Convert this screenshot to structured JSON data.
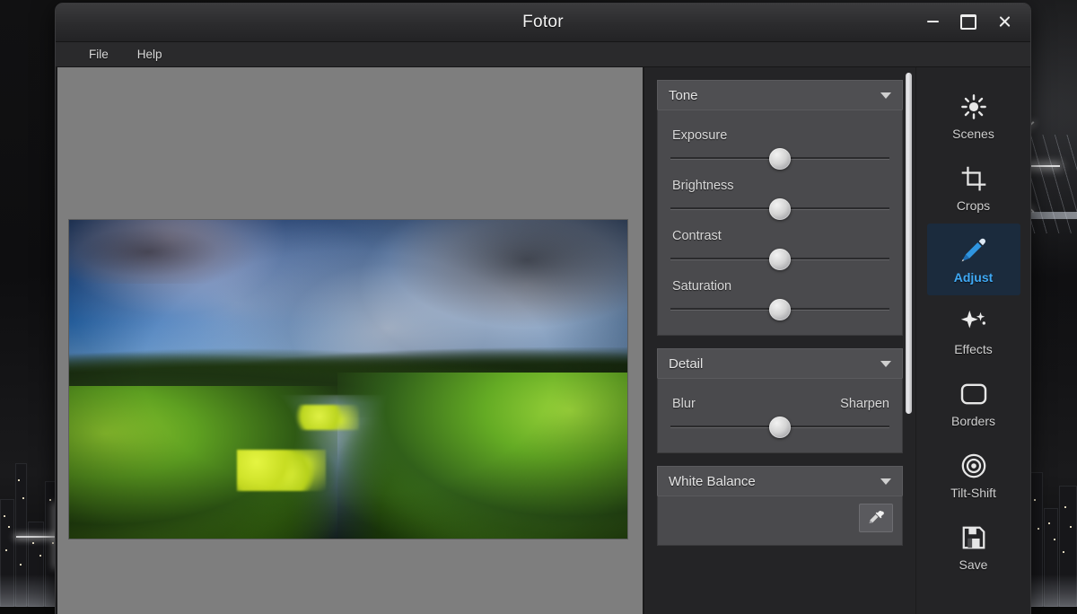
{
  "window": {
    "title": "Fotor",
    "controls": [
      {
        "name": "minimize",
        "label": "Minimize"
      },
      {
        "name": "maximize",
        "label": "Maximize"
      },
      {
        "name": "close",
        "label": "Close"
      }
    ]
  },
  "menu": {
    "items": [
      {
        "label": "File"
      },
      {
        "label": "Help"
      }
    ]
  },
  "canvas": {
    "background_color": "#7e7e7e",
    "photo_alt": "Landscape photo of a river winding through green marsh grass under a dramatic blue sky with white and grey clouds"
  },
  "panel": {
    "sections": [
      {
        "title": "Tone",
        "expanded": true,
        "caret": "chevron-down-icon",
        "sliders": [
          {
            "label": "Exposure",
            "value": 50,
            "min": 0,
            "max": 100
          },
          {
            "label": "Brightness",
            "value": 50,
            "min": 0,
            "max": 100
          },
          {
            "label": "Contrast",
            "value": 50,
            "min": 0,
            "max": 100
          },
          {
            "label": "Saturation",
            "value": 50,
            "min": 0,
            "max": 100
          }
        ]
      },
      {
        "title": "Detail",
        "expanded": true,
        "caret": "chevron-down-icon",
        "sliders": [
          {
            "label_left": "Blur",
            "label_right": "Sharpen",
            "value": 50,
            "min": 0,
            "max": 100
          }
        ]
      },
      {
        "title": "White Balance",
        "expanded": true,
        "caret": "chevron-down-icon",
        "picker_icon": "eyedropper-icon"
      }
    ],
    "scrollbar": {
      "name": "panel-scrollbar",
      "position": "visible"
    }
  },
  "toolbar": {
    "active": "Adjust",
    "accent_color": "#3fa9f5",
    "items": [
      {
        "label": "Scenes",
        "icon": "sun-icon",
        "active": false
      },
      {
        "label": "Crops",
        "icon": "crop-icon",
        "active": false
      },
      {
        "label": "Adjust",
        "icon": "pencil-icon",
        "active": true
      },
      {
        "label": "Effects",
        "icon": "sparkles-icon",
        "active": false
      },
      {
        "label": "Borders",
        "icon": "rounded-rectangle-icon",
        "active": false
      },
      {
        "label": "Tilt-Shift",
        "icon": "target-icon",
        "active": false
      },
      {
        "label": "Save",
        "icon": "floppy-disk-icon",
        "active": false
      }
    ]
  },
  "desktop": {
    "wallpaper": "black-and-white night city skyline with bridge light flare"
  }
}
